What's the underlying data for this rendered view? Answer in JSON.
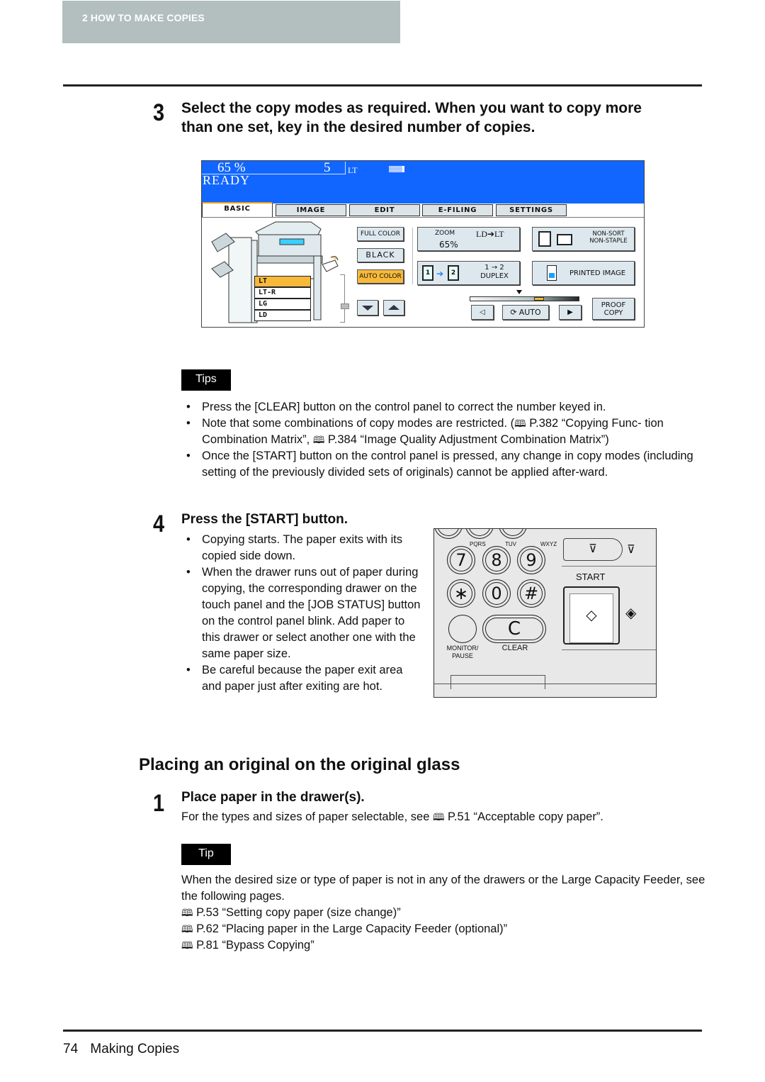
{
  "header": {
    "chapter_label": "2   HOW TO MAKE COPIES"
  },
  "step3": {
    "number": "3",
    "heading_line1": "Select the copy modes as required. When you want to copy more",
    "heading_line2": "than one set, key in the desired number of copies."
  },
  "touch_panel": {
    "zoom_readout": "65 %",
    "copies_readout": "5",
    "paper_readout": "LT",
    "status": "READY",
    "tabs": [
      "BASIC",
      "IMAGE",
      "EDIT",
      "E-FILING",
      "SETTINGS"
    ],
    "active_tab": "BASIC",
    "drawers": [
      "LT",
      "LT-R",
      "LG",
      "LD"
    ],
    "selected_drawer": "LT",
    "color_buttons": {
      "full_color": "FULL COLOR",
      "black": "BLACK",
      "auto_color": "AUTO COLOR"
    },
    "zoom_button": {
      "label": "ZOOM",
      "ratio": "LD➔LT",
      "value": "65%"
    },
    "sort_button": {
      "line1": "NON-SORT",
      "line2": "NON-STAPLE"
    },
    "duplex_button": {
      "line1": "1 → 2",
      "line2": "DUPLEX",
      "page1": "1",
      "page2": "2"
    },
    "printed_image_button": "PRINTED IMAGE",
    "density": {
      "auto_label": "AUTO",
      "level_fraction": 0.5
    },
    "proof_copy_button": {
      "line1": "PROOF",
      "line2": "COPY"
    }
  },
  "tips": {
    "badge": "Tips",
    "items": [
      {
        "text": "Press the [CLEAR] button on the control panel to correct the number keyed in."
      },
      {
        "text_a": "Note that some combinations of copy modes are restricted. (",
        "ref1": " P.382 “Copying Func-",
        "text_b": "tion Combination Matrix”, ",
        "ref2": " P.384 “Image Quality Adjustment Combination Matrix”)"
      },
      {
        "text": "Once the [START] button on the control panel is pressed, any change in copy modes (including setting of the previously divided sets of originals) cannot be applied after-ward."
      }
    ]
  },
  "step4": {
    "number": "4",
    "heading": "Press the [START] button.",
    "bullets": [
      "Copying starts. The paper exits with its copied side down.",
      "When the drawer runs out of paper during copying, the corresponding drawer on the touch panel and the [JOB STATUS] button on the control panel blink. Add paper to this drawer or select another one with the same paper size.",
      "Be careful because the paper exit area and paper just after exiting are hot."
    ]
  },
  "control_panel": {
    "keys": [
      {
        "digit": "7",
        "letters": "PQRS"
      },
      {
        "digit": "8",
        "letters": "TUV"
      },
      {
        "digit": "9",
        "letters": "WXYZ"
      },
      {
        "digit": "∗",
        "letters": ""
      },
      {
        "digit": "0",
        "letters": ""
      },
      {
        "digit": "#",
        "letters": ""
      }
    ],
    "clear_key": "C",
    "clear_label": "CLEAR",
    "monitor_label_line1": "MONITOR/",
    "monitor_label_line2": "PAUSE",
    "start_label": "START"
  },
  "section": {
    "title": "Placing an original on the original glass",
    "step1": {
      "number": "1",
      "heading": "Place paper in the drawer(s).",
      "body_a": "For the types and sizes of paper selectable, see ",
      "body_ref": " P.51 “Acceptable copy paper”."
    },
    "tip": {
      "badge": "Tip",
      "text": "When the desired size or type of paper is not in any of the drawers or the Large Capacity Feeder, see the following pages.",
      "refs": [
        " P.53 “Setting copy paper (size change)”",
        " P.62 “Placing paper in the Large Capacity Feeder (optional)”",
        " P.81 “Bypass Copying”"
      ]
    }
  },
  "footer": {
    "page_number": "74",
    "section_name": "Making Copies"
  },
  "icons": {
    "book": "🕮"
  }
}
